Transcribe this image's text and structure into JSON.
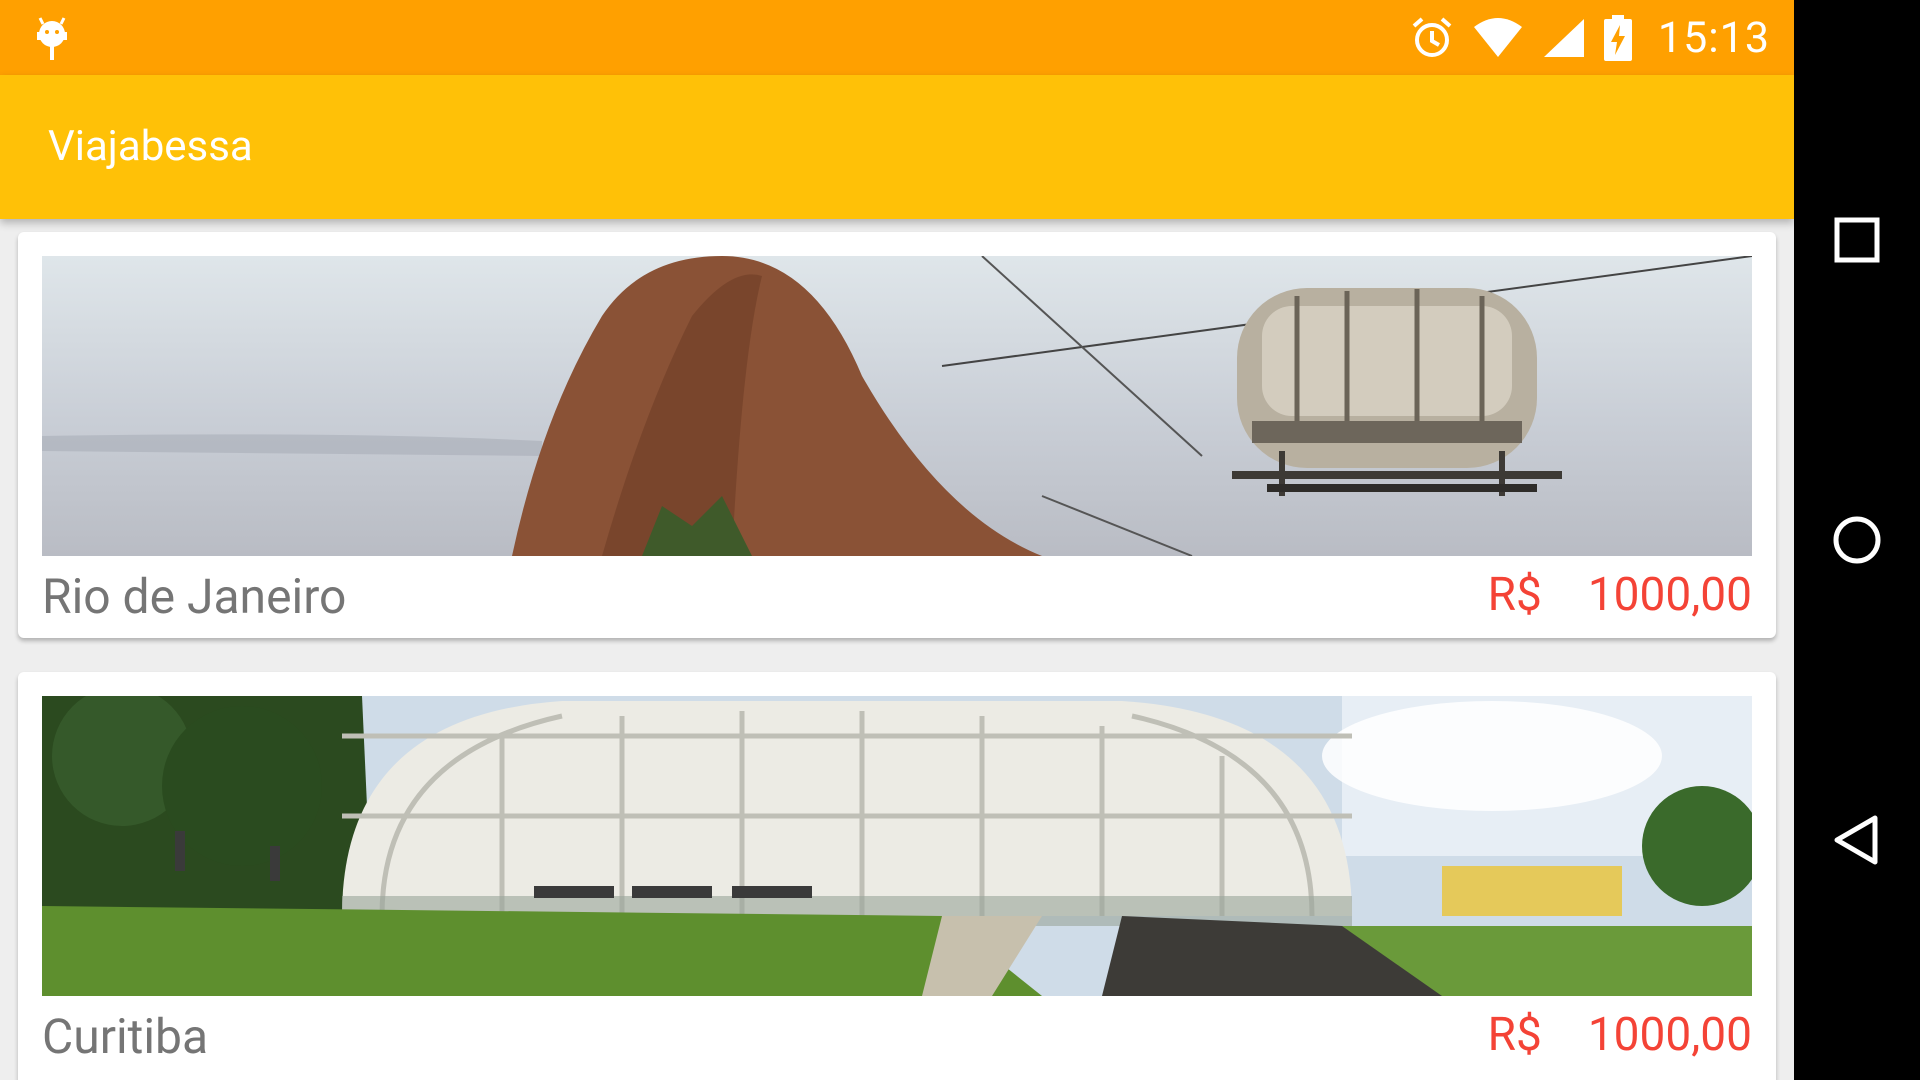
{
  "status_bar": {
    "time": "15:13"
  },
  "toolbar": {
    "title": "Viajabessa"
  },
  "destinations": [
    {
      "city": "Rio de Janeiro",
      "currency": "R$",
      "price": "1000,00"
    },
    {
      "city": "Curitiba",
      "currency": "R$",
      "price": "1000,00"
    }
  ],
  "colors": {
    "status_bar": "#FFA000",
    "toolbar": "#FFC107",
    "price": "#F44336",
    "city_text": "#757575"
  }
}
